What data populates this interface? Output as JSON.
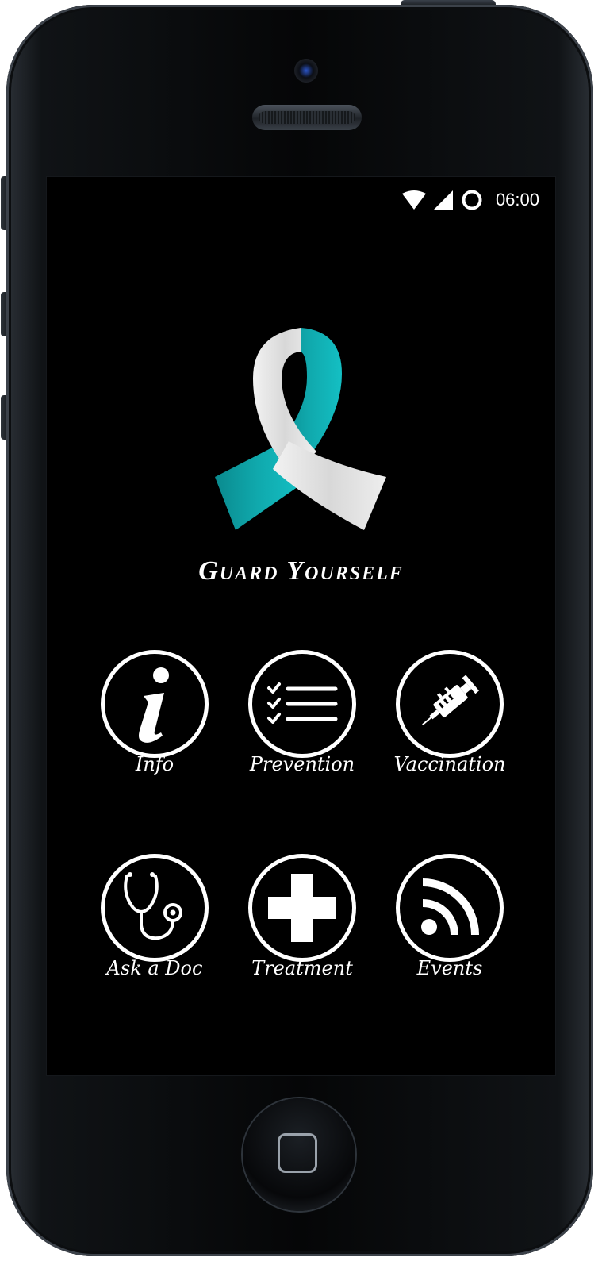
{
  "status_bar": {
    "time": "06:00",
    "icons": [
      "wifi-icon",
      "cell-signal-icon",
      "circle-icon"
    ]
  },
  "app": {
    "title": "Guard Yourself",
    "logo": "awareness-ribbon-icon",
    "colors": {
      "ribbon_teal": "#10a9ad",
      "ribbon_white": "#e6e6e6",
      "background": "#000000",
      "foreground": "#ffffff"
    }
  },
  "menu": {
    "items": [
      {
        "label": "Info",
        "icon": "info-icon"
      },
      {
        "label": "Prevention",
        "icon": "checklist-icon"
      },
      {
        "label": "Vaccination",
        "icon": "syringe-icon"
      },
      {
        "label": "Ask a Doc",
        "icon": "stethoscope-icon"
      },
      {
        "label": "Treatment",
        "icon": "medical-cross-icon"
      },
      {
        "label": "Events",
        "icon": "rss-feed-icon"
      }
    ]
  }
}
